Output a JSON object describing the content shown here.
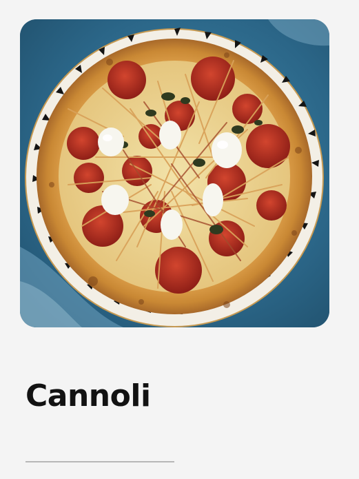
{
  "card": {
    "title": "Cannoli",
    "image": {
      "subject": "pizza-photo"
    }
  },
  "colors": {
    "background": "#f4f4f4",
    "title": "#121212",
    "divider": "#b7b7b7",
    "table": "#2e6f93"
  }
}
